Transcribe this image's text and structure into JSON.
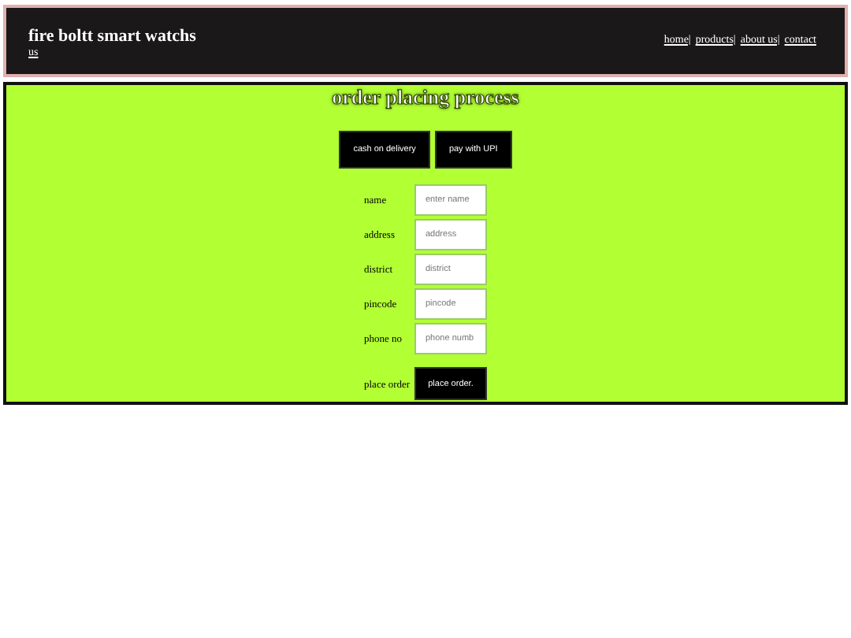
{
  "header": {
    "title": "fire boltt smart watchs",
    "nav": [
      "home|",
      "products|",
      "about us|",
      "contact"
    ],
    "nav_wrap": "us"
  },
  "main": {
    "heading": "order placing process",
    "payment_buttons": [
      "cash on delivery",
      "pay with UPI"
    ],
    "fields": [
      {
        "label": "name",
        "placeholder": "enter name"
      },
      {
        "label": "address",
        "placeholder": "address"
      },
      {
        "label": "district",
        "placeholder": "district"
      },
      {
        "label": "pincode",
        "placeholder": "pincode"
      },
      {
        "label": "phone no",
        "placeholder": "phone numb"
      }
    ],
    "submit": {
      "label": "place order",
      "button": "place order."
    }
  }
}
